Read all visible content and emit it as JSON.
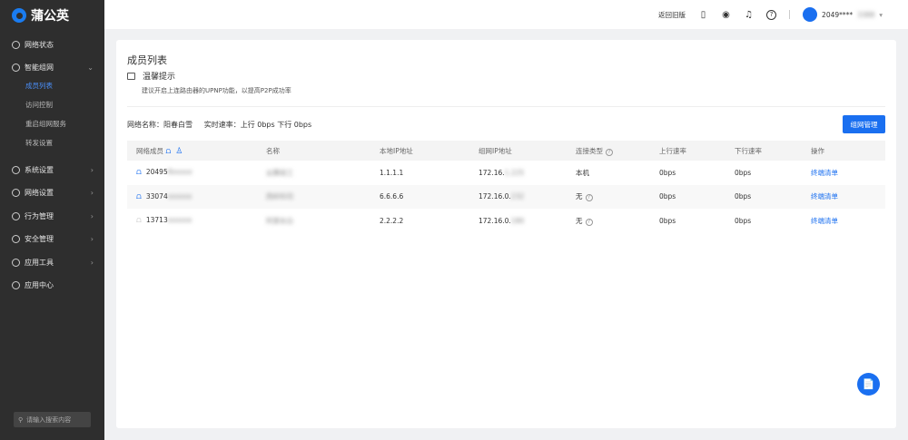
{
  "brand": "蒲公英",
  "sidebar": {
    "items": [
      {
        "label": "网络状态",
        "icon": "globe-icon"
      },
      {
        "label": "智能组网",
        "icon": "network-icon",
        "expanded": true,
        "children": [
          {
            "label": "成员列表",
            "active": true
          },
          {
            "label": "访问控制"
          },
          {
            "label": "重启组网服务"
          },
          {
            "label": "转发设置"
          }
        ]
      },
      {
        "label": "系统设置",
        "icon": "gear-icon"
      },
      {
        "label": "网络设置",
        "icon": "list-icon"
      },
      {
        "label": "行为管理",
        "icon": "behavior-icon"
      },
      {
        "label": "安全管理",
        "icon": "shield-icon"
      },
      {
        "label": "应用工具",
        "icon": "tool-icon"
      },
      {
        "label": "应用中心",
        "icon": "grid-icon"
      }
    ],
    "search_placeholder": "请输入搜索内容"
  },
  "topbar": {
    "back_label": "返回旧版",
    "user": "2049****",
    "user_blurred": "3388"
  },
  "page": {
    "title": "成员列表",
    "tip_title": "温馨提示",
    "tip_desc": "建议开启上连路由器的UPNP功能，以提高P2P成功率",
    "net_info": "网络名称：阳春白雪     实时速率：上行 0bps 下行 0bps",
    "manage_button": "组网管理"
  },
  "table": {
    "headers": [
      "网络成员",
      "名称",
      "本地IP地址",
      "组网IP地址",
      "连接类型",
      "上行速率",
      "下行速率",
      "操作"
    ],
    "rows": [
      {
        "member": "20495",
        "member_blur": "8xxxxx",
        "name": "云赛组工",
        "local_ip": "1.1.1.1",
        "net_ip": "172.16.",
        "net_ip_blur": "1.225",
        "type": "本机",
        "type_help": false,
        "up": "0bps",
        "down": "0bps",
        "action": "终端清单",
        "online": true
      },
      {
        "member": "33074",
        "member_blur": "xxxxxx",
        "name": "西岭科司",
        "local_ip": "6.6.6.6",
        "net_ip": "172.16.0.",
        "net_ip_blur": "232",
        "type": "无",
        "type_help": true,
        "up": "0bps",
        "down": "0bps",
        "action": "终端清单",
        "online": true
      },
      {
        "member": "13713",
        "member_blur": "xxxxxx",
        "name": "阿里长白",
        "local_ip": "2.2.2.2",
        "net_ip": "172.16.0.",
        "net_ip_blur": "180",
        "type": "无",
        "type_help": true,
        "up": "0bps",
        "down": "0bps",
        "action": "终端清单",
        "online": false
      }
    ]
  },
  "colors": {
    "accent": "#1a6ff0",
    "sidebar": "#2e2e2e"
  }
}
